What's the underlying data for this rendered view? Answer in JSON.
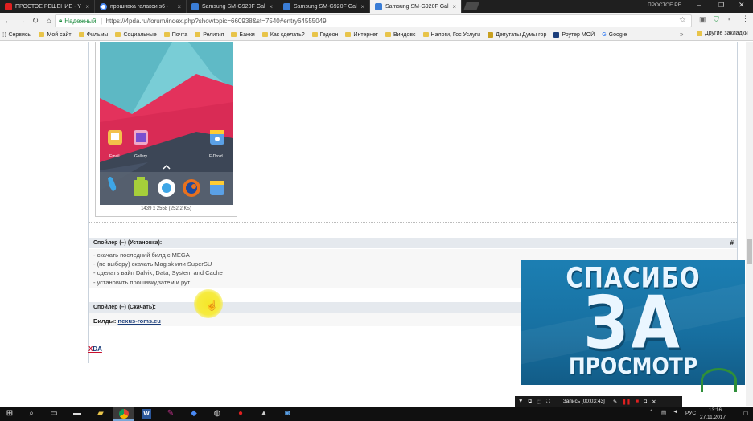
{
  "tabs": [
    {
      "label": "ПРОСТОЕ РЕШЕНИЕ - Y",
      "icon": "youtube-icon",
      "color": "#e02020"
    },
    {
      "label": "прошивка галакси s6 -",
      "icon": "google-icon",
      "color": "#4a8af4"
    },
    {
      "label": "Samsung SM-G920F Gal",
      "icon": "4pda-icon",
      "color": "#3a7dd6"
    },
    {
      "label": "Samsung SM-G920F Gal",
      "icon": "4pda-icon",
      "color": "#3a7dd6"
    },
    {
      "label": "Samsung SM-G920F Gal",
      "icon": "4pda-icon",
      "color": "#3a7dd6",
      "active": true
    }
  ],
  "window_title": "ПРОСТОЕ РЕ...",
  "address": {
    "secure_label": "Надежный",
    "url": "https://4pda.ru/forum/index.php?showtopic=660938&st=7540#entry64555049"
  },
  "bookmarks": {
    "items": [
      {
        "label": "Сервисы",
        "icon": "apps-icon"
      },
      {
        "label": "Мой сайт",
        "icon": "folder-icon"
      },
      {
        "label": "Фильмы",
        "icon": "folder-icon"
      },
      {
        "label": "Социальные",
        "icon": "folder-icon"
      },
      {
        "label": "Почта",
        "icon": "folder-icon"
      },
      {
        "label": "Религия",
        "icon": "folder-icon"
      },
      {
        "label": "Банки",
        "icon": "folder-icon"
      },
      {
        "label": "Как сделать?",
        "icon": "folder-icon"
      },
      {
        "label": "Гедеон",
        "icon": "folder-icon"
      },
      {
        "label": "Интернет",
        "icon": "folder-icon"
      },
      {
        "label": "Виндовс",
        "icon": "folder-icon"
      },
      {
        "label": "Налоги, Гос Услуги",
        "icon": "folder-icon"
      },
      {
        "label": "Депутаты Думы гор",
        "icon": "site-icon"
      },
      {
        "label": "Роутер МОЙ",
        "icon": "router-icon"
      },
      {
        "label": "Google",
        "icon": "google-icon"
      }
    ],
    "more": "»",
    "other": "Другие закладки"
  },
  "post": {
    "phone": {
      "apps": [
        "Email",
        "Gallery",
        "F-Droid"
      ]
    },
    "image_caption": "1439 x 2558 (252.2 КБ)",
    "spoiler1": {
      "title": "Спойлер (–) (Установка):",
      "hash": "#",
      "lines": [
        "- скачать последний билд с MEGA",
        "- (по выбору) скачать Magisk или SuperSU",
        "- сделать вайп Dalvik, Data, System and Cache",
        "- установить прошивку,затем и рут"
      ]
    },
    "spoiler2": {
      "title": "Спойлер (–) (Скачать):",
      "builds_label": "Билды:",
      "builds_link": "nexus-roms.eu"
    },
    "xda_x": "X",
    "xda_rest": "DA"
  },
  "overlay": {
    "line1": "СПАСИБО",
    "line2": "ЗА",
    "line3": "ПРОСМОТР"
  },
  "recorder": {
    "status": "Запись [00:03:43]"
  },
  "tray": {
    "lang": "РУС",
    "time": "13:16",
    "date": "27.11.2017"
  }
}
